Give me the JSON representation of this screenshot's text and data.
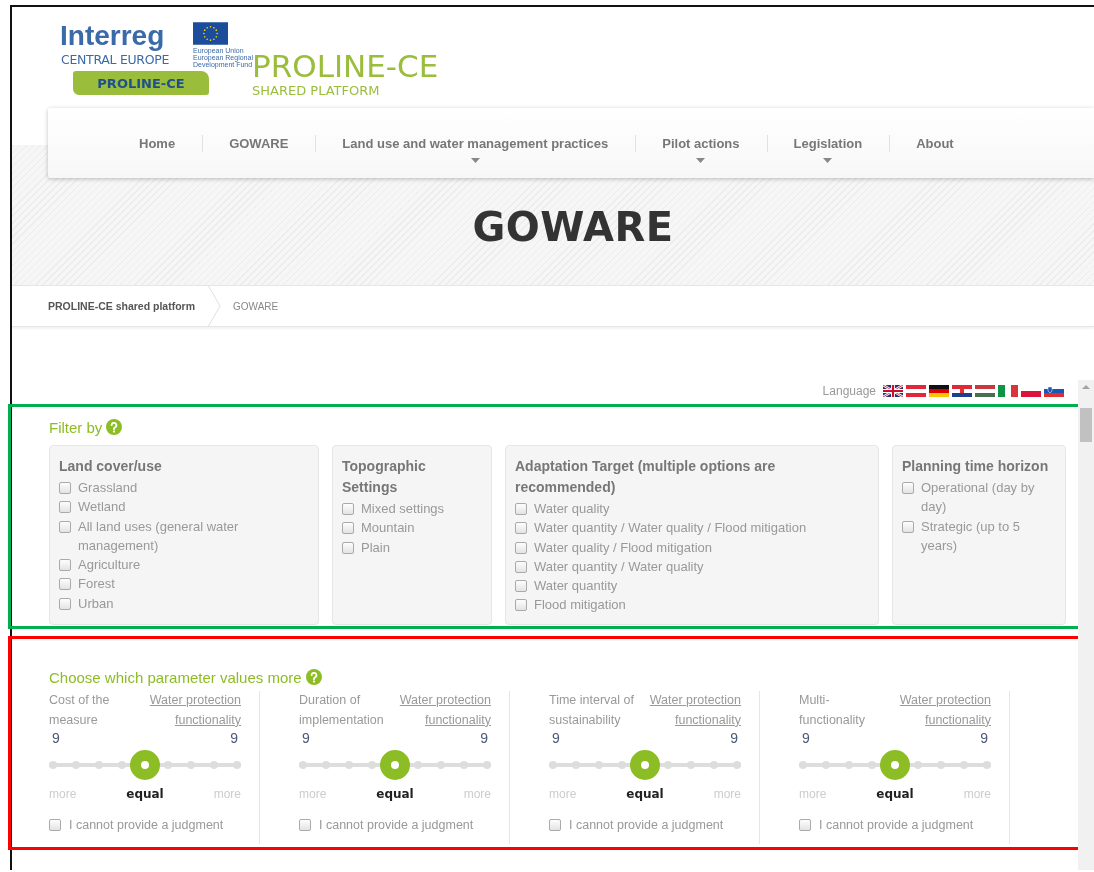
{
  "logo": {
    "wordmark": "Interreg",
    "region": "CENTRAL EUROPE",
    "fund": [
      "European Union",
      "European Regional",
      "Development Fund"
    ],
    "badge": "PROLINE-CE"
  },
  "site": {
    "title": "PROLINE-CE",
    "subtitle": "SHARED PLATFORM"
  },
  "nav": [
    {
      "label": "Home",
      "dropdown": false
    },
    {
      "label": "GOWARE",
      "dropdown": false
    },
    {
      "label": "Land use and water management practices",
      "dropdown": true
    },
    {
      "label": "Pilot actions",
      "dropdown": true
    },
    {
      "label": "Legislation",
      "dropdown": true
    },
    {
      "label": "About",
      "dropdown": false
    }
  ],
  "page_title": "GOWARE",
  "breadcrumb": [
    "PROLINE-CE shared platform",
    "GOWARE"
  ],
  "language": {
    "label": "Language"
  },
  "filter": {
    "title": "Filter by",
    "groups": [
      {
        "title": "Land cover/use",
        "options": [
          {
            "label": "Grassland",
            "checked": false
          },
          {
            "label": "Wetland",
            "checked": false
          },
          {
            "label": "All land uses (general water management)",
            "checked": false
          },
          {
            "label": "Agriculture",
            "checked": false
          },
          {
            "label": "Forest",
            "checked": false
          },
          {
            "label": "Urban",
            "checked": false
          }
        ]
      },
      {
        "title": "Topographic Settings",
        "options": [
          {
            "label": "Mixed settings",
            "checked": false
          },
          {
            "label": "Mountain",
            "checked": false
          },
          {
            "label": "Plain",
            "checked": false
          }
        ]
      },
      {
        "title": "Adaptation Target (multiple options are recommended)",
        "options": [
          {
            "label": "Water quality",
            "checked": false
          },
          {
            "label": "Water quantity / Water quality / Flood mitigation",
            "checked": false
          },
          {
            "label": "Water quality / Flood mitigation",
            "checked": false
          },
          {
            "label": "Water quantity / Water quality",
            "checked": false
          },
          {
            "label": "Water quantity",
            "checked": false
          },
          {
            "label": "Flood mitigation",
            "checked": false
          }
        ]
      },
      {
        "title": "Planning time horizon",
        "options": [
          {
            "label": "Operational (day by day)",
            "checked": false
          },
          {
            "label": "Strategic (up to 5 years)",
            "checked": false
          }
        ]
      }
    ]
  },
  "parameters": {
    "title": "Choose which parameter values more",
    "comparisons": [
      {
        "left": "Cost of the measure",
        "right": "Water protection functionality",
        "left_value": "9",
        "right_value": "9",
        "level": 0.5,
        "scale": [
          "more",
          "equal",
          "more"
        ],
        "no_judgment": {
          "label": "I cannot provide a judgment",
          "checked": false
        }
      },
      {
        "left": "Duration of implementation",
        "right": "Water protection functionality",
        "left_value": "9",
        "right_value": "9",
        "level": 0.5,
        "scale": [
          "more",
          "equal",
          "more"
        ],
        "no_judgment": {
          "label": "I cannot provide a judgment",
          "checked": false
        }
      },
      {
        "left": "Time interval of sustainability",
        "right": "Water protection functionality",
        "left_value": "9",
        "right_value": "9",
        "level": 0.5,
        "scale": [
          "more",
          "equal",
          "more"
        ],
        "no_judgment": {
          "label": "I cannot provide a judgment",
          "checked": false
        }
      },
      {
        "left": "Multi-functionality",
        "right": "Water protection functionality",
        "left_value": "9",
        "right_value": "9",
        "level": 0.5,
        "scale": [
          "more",
          "equal",
          "more"
        ],
        "no_judgment": {
          "label": "I cannot provide a judgment",
          "checked": false
        }
      }
    ]
  }
}
